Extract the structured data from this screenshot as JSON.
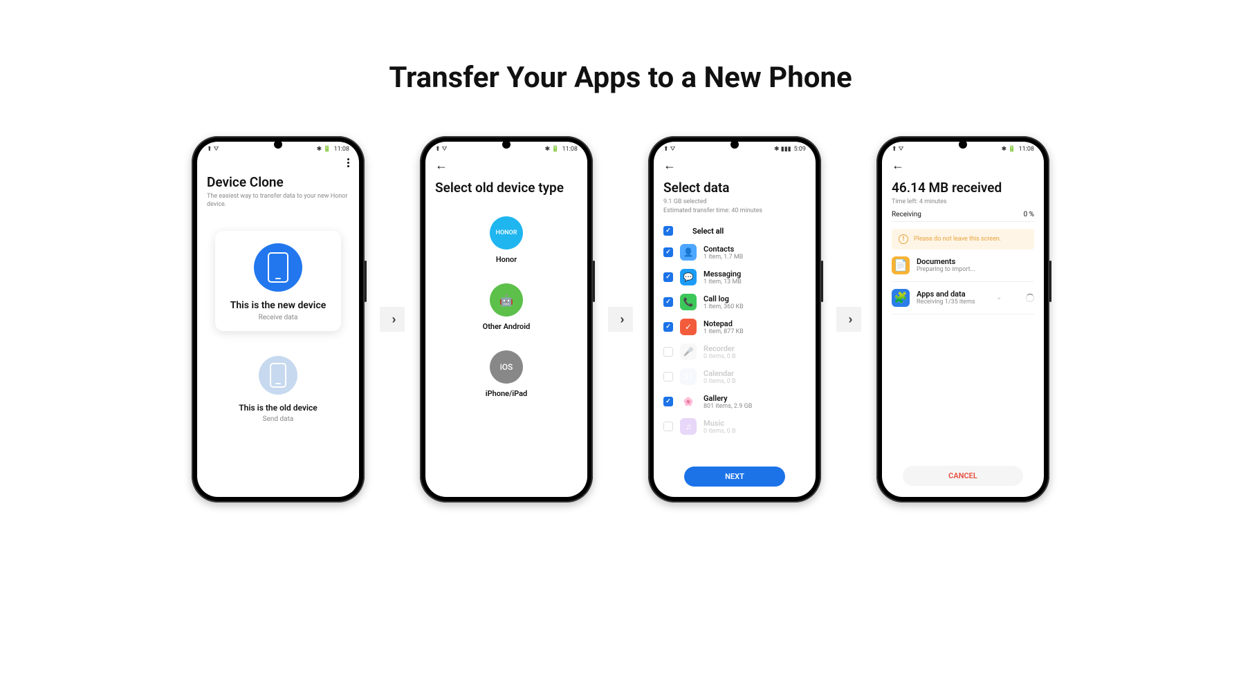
{
  "page_title": "Transfer Your Apps to a New Phone",
  "arrow": "›››",
  "status": {
    "time1": "11:08",
    "time2": "5:09",
    "battery_icon": "⚡",
    "signal": "📶"
  },
  "screen1": {
    "title": "Device Clone",
    "subtitle": "The easiest way to transfer data to your new Honor device.",
    "new_title": "This is the new device",
    "new_sub": "Receive data",
    "old_title": "This is the old device",
    "old_sub": "Send data"
  },
  "screen2": {
    "title": "Select old device type",
    "honor": "Honor",
    "honor_badge": "HONOR",
    "android": "Other Android",
    "android_badge": "🤖",
    "ios": "iPhone/iPad",
    "ios_badge": "iOS"
  },
  "screen3": {
    "title": "Select data",
    "size": "9.1 GB selected",
    "eta": "Estimated transfer time: 40 minutes",
    "select_all": "Select all",
    "items": [
      {
        "name": "Contacts",
        "detail": "1 item, 1.7 MB",
        "checked": true,
        "color": "#4da6ff",
        "glyph": "👤"
      },
      {
        "name": "Messaging",
        "detail": "1 item, 13 MB",
        "checked": true,
        "color": "#1c9cf6",
        "glyph": "💬"
      },
      {
        "name": "Call log",
        "detail": "1 item, 360 KB",
        "checked": true,
        "color": "#3cc75a",
        "glyph": "📞"
      },
      {
        "name": "Notepad",
        "detail": "1 item, 877 KB",
        "checked": true,
        "color": "#f25c3c",
        "glyph": "✓"
      },
      {
        "name": "Recorder",
        "detail": "0 items, 0 B",
        "checked": false,
        "color": "#f0f0f0",
        "glyph": "🎤"
      },
      {
        "name": "Calendar",
        "detail": "0 items, 0 B",
        "checked": false,
        "color": "#e8f0f8",
        "glyph": "31"
      },
      {
        "name": "Gallery",
        "detail": "801 items, 2.9 GB",
        "checked": true,
        "color": "#fff",
        "glyph": "🌸"
      },
      {
        "name": "Music",
        "detail": "0 items, 0 B",
        "checked": false,
        "color": "#c89cf0",
        "glyph": "♫"
      }
    ],
    "next": "NEXT"
  },
  "screen4": {
    "title": "46.14 MB received",
    "time_left": "Time left: 4 minutes",
    "status_label": "Receiving",
    "percent": "0 %",
    "warning": "Please do not leave this screen.",
    "items": [
      {
        "name": "Documents",
        "detail": "Preparing to import...",
        "color": "#f9b233",
        "glyph": "📄"
      },
      {
        "name": "Apps and data",
        "detail": "Receiving 1/35 items",
        "color": "#2b7de9",
        "glyph": "🧩"
      }
    ],
    "cancel": "CANCEL"
  }
}
